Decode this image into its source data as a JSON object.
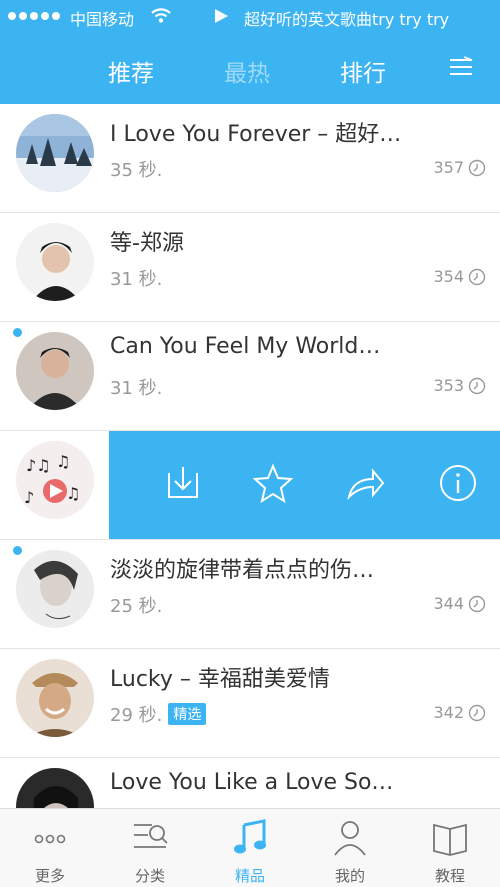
{
  "status": {
    "carrier": "中国移动",
    "now_playing": "超好听的英文歌曲try try try"
  },
  "tabs": [
    {
      "label": "推荐",
      "active": true
    },
    {
      "label": "最热",
      "active": false
    },
    {
      "label": "排行",
      "active": true
    }
  ],
  "songs": [
    {
      "title": "I Love You Forever – 超好…",
      "duration": "35 秒.",
      "plays": "357",
      "badge": "",
      "new_dot": false
    },
    {
      "title": "等-郑源",
      "duration": "31 秒.",
      "plays": "354",
      "badge": "",
      "new_dot": false
    },
    {
      "title": "Can You Feel My World…",
      "duration": "31 秒.",
      "plays": "353",
      "badge": "",
      "new_dot": true
    },
    {
      "title": "",
      "duration": "",
      "plays": "",
      "badge": "",
      "new_dot": false
    },
    {
      "title": "淡淡的旋律带着点点的伤…",
      "duration": "25 秒.",
      "plays": "344",
      "badge": "",
      "new_dot": true
    },
    {
      "title": "Lucky – 幸福甜美爱情",
      "duration": "29 秒.",
      "plays": "342",
      "badge": "精选",
      "new_dot": false
    },
    {
      "title": "Love You Like a Love So…",
      "duration": "",
      "plays": "",
      "badge": "",
      "new_dot": false
    }
  ],
  "actions": [
    "download-icon",
    "star-icon",
    "share-icon",
    "info-icon"
  ],
  "nav": [
    {
      "label": "更多",
      "icon": "more-icon"
    },
    {
      "label": "分类",
      "icon": "category-icon"
    },
    {
      "label": "精品",
      "icon": "music-note-icon",
      "active": true
    },
    {
      "label": "我的",
      "icon": "person-icon"
    },
    {
      "label": "教程",
      "icon": "book-icon"
    }
  ],
  "colors": {
    "accent": "#3db4f2"
  }
}
